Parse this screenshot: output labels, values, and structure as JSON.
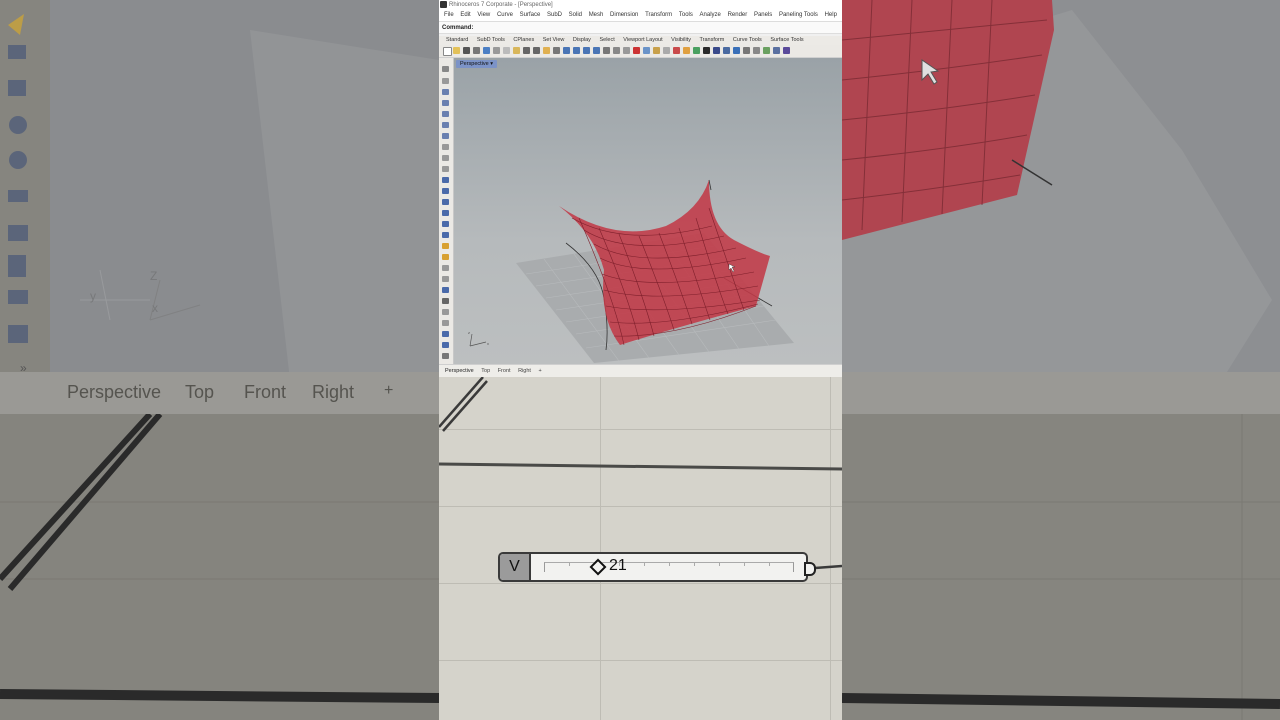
{
  "window": {
    "title": "Rhinoceros 7 Corporate - [Perspective]",
    "command_label": "Command:"
  },
  "menu": [
    "File",
    "Edit",
    "View",
    "Curve",
    "Surface",
    "SubD",
    "Solid",
    "Mesh",
    "Dimension",
    "Transform",
    "Tools",
    "Analyze",
    "Render",
    "Panels",
    "Paneling Tools",
    "Help"
  ],
  "toolbar_tabs": [
    "Standard",
    "SubD Tools",
    "CPlanes",
    "Set View",
    "Display",
    "Select",
    "Viewport Layout",
    "Visibility",
    "Transform",
    "Curve Tools",
    "Surface Tools"
  ],
  "viewport": {
    "label": "Perspective",
    "dropdown_icon": "chevron-down-icon"
  },
  "viewport_tabs": [
    "Perspective",
    "Top",
    "Front",
    "Right"
  ],
  "add_tab_icon": "plus-icon",
  "background_tabs": [
    "Perspective",
    "Top",
    "Front",
    "Right"
  ],
  "grasshopper": {
    "slider": {
      "cap_label": "V",
      "value": "21"
    }
  },
  "colors": {
    "surface": "#c23a48",
    "viewport_tag": "#7c93c7",
    "canvas": "#d5d3cb"
  }
}
